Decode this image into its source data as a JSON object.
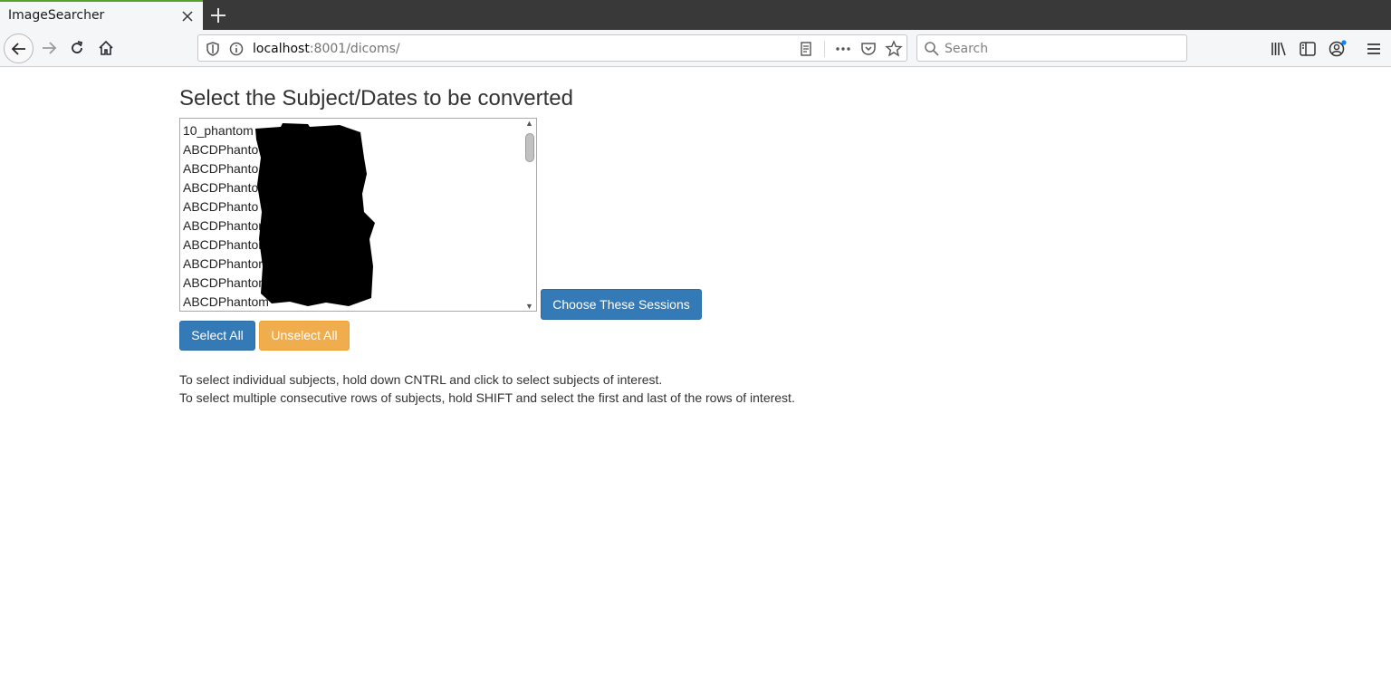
{
  "browser": {
    "tab_title": "ImageSearcher",
    "url_host": "localhost",
    "url_rest": ":8001/dicoms/",
    "search_placeholder": "Search"
  },
  "page": {
    "heading": "Select the Subject/Dates to be converted",
    "subjects": [
      "10_phantom",
      "ABCDPhanto",
      "ABCDPhanto",
      "ABCDPhanto",
      "ABCDPhanto",
      "ABCDPhantor",
      "ABCDPhantor",
      "ABCDPhantor",
      "ABCDPhantom",
      "ABCDPhantom"
    ],
    "choose_button": "Choose These Sessions",
    "select_all_button": "Select All",
    "unselect_all_button": "Unselect All",
    "help_line_1": "To select individual subjects, hold down CNTRL and click to select subjects of interest.",
    "help_line_2": "To select multiple consecutive rows of subjects, hold SHIFT and select the first and last of the rows of interest."
  },
  "colors": {
    "primary": "#337ab7",
    "warning": "#f0ad4e",
    "redaction": "#000000"
  }
}
